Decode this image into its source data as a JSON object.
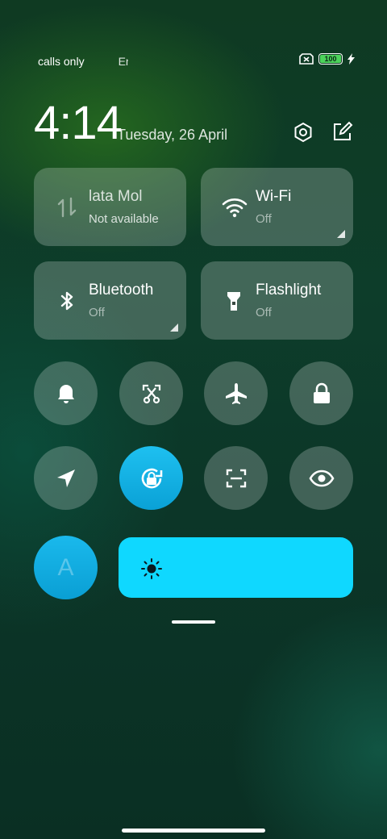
{
  "status_bar": {
    "carrier1": "calls only",
    "carrier2": "Er",
    "battery_level": "100",
    "icons": [
      "no-sim-icon",
      "battery-icon",
      "charging-bolt-icon"
    ]
  },
  "header": {
    "time": "4:14",
    "date": "Tuesday, 26 April",
    "icons": [
      "settings-icon",
      "edit-icon"
    ]
  },
  "tiles": {
    "mobile_data": {
      "label": "lata      Mol",
      "sub": "Not available",
      "icon": "mobile-data-icon"
    },
    "wifi": {
      "label": "Wi-Fi",
      "sub": "Off",
      "icon": "wifi-icon"
    },
    "bluetooth": {
      "label": "Bluetooth",
      "sub": "Off",
      "icon": "bluetooth-icon"
    },
    "flashlight": {
      "label": "Flashlight",
      "sub": "Off",
      "icon": "flashlight-icon"
    }
  },
  "toggles_row1": [
    "bell-icon",
    "screenshot-icon",
    "airplane-icon",
    "lock-icon"
  ],
  "toggles_row2": [
    "location-icon",
    "rotation-lock-icon",
    "scanner-icon",
    "eye-icon"
  ],
  "toggles_state": {
    "rotation_lock": true
  },
  "auto_brightness": {
    "label": "A",
    "icon": "auto-brightness-icon"
  },
  "brightness": {
    "level_fraction": 1.0,
    "icon": "sun-icon"
  },
  "colors": {
    "accent": "#0fd8ff",
    "active_toggle": "#12b4e8",
    "tile_bg": "rgba(255,255,255,0.22)"
  }
}
